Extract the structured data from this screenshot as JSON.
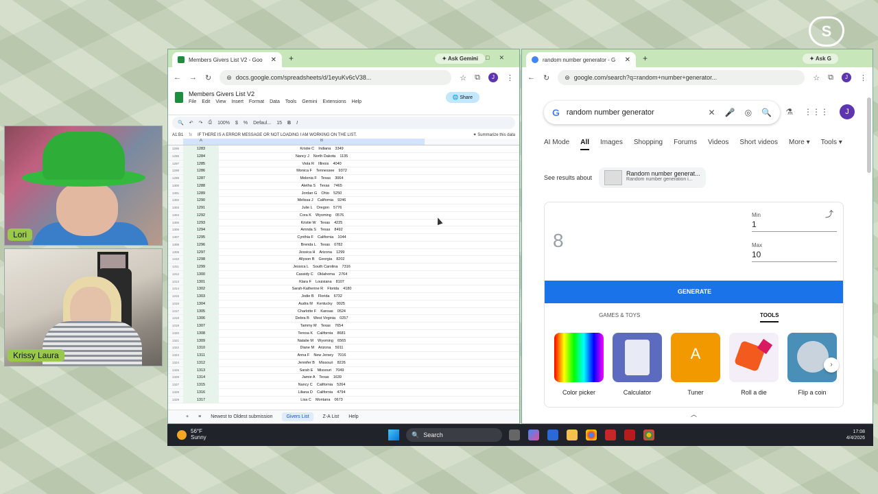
{
  "stream": {
    "brand": "streamyard",
    "participants": [
      {
        "name": "Lori"
      },
      {
        "name": "Krissy Laura"
      }
    ]
  },
  "left_browser": {
    "tab_title": "Members Givers List V2 - Goo",
    "ask_gemini": "Ask Gemini",
    "url": "docs.google.com/spreadsheets/d/1eyuKv6cV38...",
    "doc_title": "Members Givers List V2",
    "menu": [
      "File",
      "Edit",
      "View",
      "Insert",
      "Format",
      "Data",
      "Tools",
      "Gemini",
      "Extensions",
      "Help"
    ],
    "share_label": "Share",
    "toolbar": {
      "zoom": "100%",
      "currency": "$",
      "percent": "%",
      "font": "Defaul...",
      "font_size": "15",
      "bold": "B",
      "italic": "I"
    },
    "cell_ref": "A1:B1",
    "formula_text": "IF THERE IS A ERROR MESSAGE OR NOT LOADING I AM WORKING ON THE LIST.",
    "summarize": "Summarize this data",
    "col_a": "A",
    "col_b": "B",
    "rows": [
      {
        "rn": "1295",
        "id": "1283",
        "val": "Kristie C    Indiana    3349"
      },
      {
        "rn": "1296",
        "id": "1284",
        "val": "Nancy J    North Dakota    1135"
      },
      {
        "rn": "1297",
        "id": "1285",
        "val": "Viola R    Illinois    4040"
      },
      {
        "rn": "1298",
        "id": "1286",
        "val": "Monica F    Tennessee    9372"
      },
      {
        "rn": "1299",
        "id": "1287",
        "val": "Melenia F    Texas    3064"
      },
      {
        "rn": "1300",
        "id": "1288",
        "val": "Aletha S    Texas    7465"
      },
      {
        "rn": "1301",
        "id": "1289",
        "val": "Jordan G    Ohio    5250"
      },
      {
        "rn": "1302",
        "id": "1290",
        "val": "Melissa J    California    9246"
      },
      {
        "rn": "1303",
        "id": "1291",
        "val": "Julie L    Oregon    5776"
      },
      {
        "rn": "1304",
        "id": "1292",
        "val": "Cora K    Wyoming    0576"
      },
      {
        "rn": "1305",
        "id": "1293",
        "val": "Kristie W    Texas    4225"
      },
      {
        "rn": "1306",
        "id": "1294",
        "val": "Amnda S    Texas    8492"
      },
      {
        "rn": "1307",
        "id": "1295",
        "val": "Cynthia F    California    1044"
      },
      {
        "rn": "1308",
        "id": "1296",
        "val": "Brenda L    Texas    0782"
      },
      {
        "rn": "1309",
        "id": "1297",
        "val": "Jessica H    Arizona    1299"
      },
      {
        "rn": "1310",
        "id": "1298",
        "val": "Allyson B    Georgia    8202"
      },
      {
        "rn": "1311",
        "id": "1299",
        "val": "Jessica L    South Carolina    7316"
      },
      {
        "rn": "1312",
        "id": "1300",
        "val": "Cassidy C    Oklahoma    2764"
      },
      {
        "rn": "1313",
        "id": "1301",
        "val": "Klara F    Louisiana    8107"
      },
      {
        "rn": "1314",
        "id": "1302",
        "val": "Sarah-Katherine R    Florida    4180"
      },
      {
        "rn": "1315",
        "id": "1303",
        "val": "Jodie B    Florida    6732"
      },
      {
        "rn": "1316",
        "id": "1304",
        "val": "Audra M    Kentucky    0025"
      },
      {
        "rn": "1317",
        "id": "1305",
        "val": "Charlotte F    Kansas    0524"
      },
      {
        "rn": "1318",
        "id": "1306",
        "val": "Debra B    West Virginia    0257"
      },
      {
        "rn": "1319",
        "id": "1307",
        "val": "Tammy M    Texas    7654"
      },
      {
        "rn": "1320",
        "id": "1308",
        "val": "Teresa K    California    8681"
      },
      {
        "rn": "1321",
        "id": "1309",
        "val": "Natalie M    Wyoming    6565"
      },
      {
        "rn": "1322",
        "id": "1310",
        "val": "Diane M    Arizona    5911"
      },
      {
        "rn": "1323",
        "id": "1311",
        "val": "Anna F    New Jersey    7016"
      },
      {
        "rn": "1324",
        "id": "1312",
        "val": "Jennifer B    Missouri    8226"
      },
      {
        "rn": "1325",
        "id": "1313",
        "val": "Sarah E    Missouri    7049"
      },
      {
        "rn": "1326",
        "id": "1314",
        "val": "Jamie A    Texas    1639"
      },
      {
        "rn": "1327",
        "id": "1315",
        "val": "Nancy C    California    5264"
      },
      {
        "rn": "1328",
        "id": "1316",
        "val": "Liliana D    California    4794"
      },
      {
        "rn": "1329",
        "id": "1317",
        "val": "Lisa C    Montana    0673"
      }
    ],
    "sheet_tabs": [
      "Newest to Oldest submission",
      "Givers List",
      "Z-A List",
      "Help"
    ],
    "active_sheet": "Givers List"
  },
  "right_browser": {
    "tab_title": "random number generator - G",
    "ask_gemini": "Ask G",
    "url": "google.com/search?q=random+number+generator...",
    "query": "random number generator",
    "avatar_letter": "J",
    "search_tabs": [
      "AI Mode",
      "All",
      "Images",
      "Shopping",
      "Forums",
      "Videos",
      "Short videos",
      "More",
      "Tools"
    ],
    "active_tab": "All",
    "see_results_label": "See results about",
    "about_title": "Random number generat...",
    "about_sub": "Random number generation i...",
    "result_number": "8",
    "min_label": "Min",
    "min_value": "1",
    "max_label": "Max",
    "max_value": "10",
    "generate_label": "GENERATE",
    "category_tabs": [
      "GAMES & TOYS",
      "TOOLS"
    ],
    "active_category": "TOOLS",
    "tools": [
      "Color picker",
      "Calculator",
      "Tuner",
      "Roll a die",
      "Flip a coin"
    ],
    "tuner_glyph": "A"
  },
  "taskbar": {
    "temp": "56°F",
    "condition": "Sunny",
    "search_label": "Search",
    "time": "17:08",
    "date": "4/4/2026"
  }
}
